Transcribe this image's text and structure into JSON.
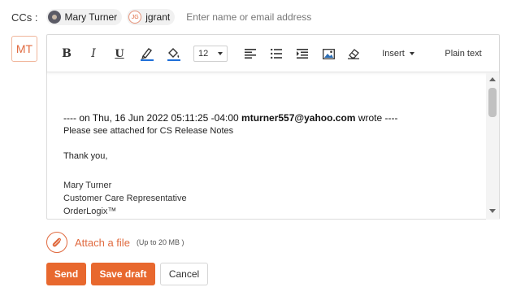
{
  "cc": {
    "label": "CCs :",
    "recipients": [
      {
        "name": "Mary Turner",
        "avatar": "photo"
      },
      {
        "name": "jgrant",
        "initials": "JG"
      }
    ],
    "placeholder": "Enter name or email address"
  },
  "sender": {
    "initials": "MT"
  },
  "toolbar": {
    "font_size": "12",
    "insert_label": "Insert",
    "plain_text_label": "Plain text",
    "icons": [
      "bold",
      "italic",
      "underline",
      "pen-icon",
      "fill-bucket-icon",
      "align-left-icon",
      "bullet-list-icon",
      "indent-icon",
      "image-icon",
      "eraser-icon"
    ],
    "bold_label": "B",
    "italic_label": "I",
    "underline_label": "U"
  },
  "body": {
    "forward_prefix": "---- on Thu, 16 Jun 2022 05:11:25 -04:00",
    "forward_email": "mturner557@yahoo.com",
    "forward_suffix": "wrote ----",
    "line1": "Please see attached for CS Release Notes",
    "line2": "Thank you,",
    "sig_name": "Mary Turner",
    "sig_title": "Customer Care Representative",
    "sig_company": "OrderLogix™"
  },
  "attach": {
    "label": "Attach a file",
    "limit": "(Up to 20 MB )"
  },
  "buttons": {
    "send": "Send",
    "save_draft": "Save draft",
    "cancel": "Cancel"
  },
  "colors": {
    "accent": "#e8682e",
    "border": "#dcdcdc"
  }
}
